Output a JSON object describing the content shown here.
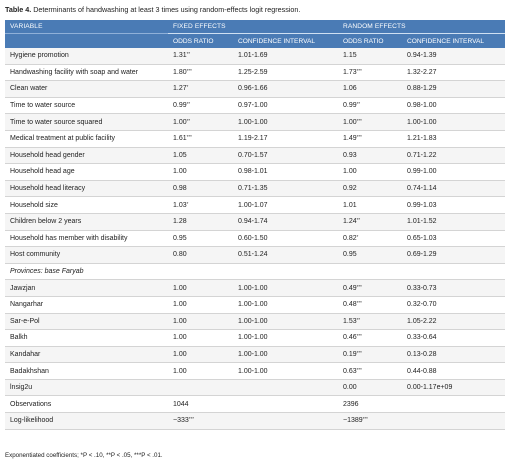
{
  "caption": {
    "label": "Table 4.",
    "text": " Determinants of handwashing at least 3 times using random-effects logit regression."
  },
  "header": {
    "variable": "VARIABLE",
    "fixed_effects": "FIXED EFFECTS",
    "random_effects": "RANDOM EFFECTS",
    "odds_ratio": "ODDS RATIO",
    "confidence_interval": "CONFIDENCE INTERVAL"
  },
  "rows": [
    {
      "variable": "Hygiene promotion",
      "fe_or": "1.31",
      "fe_sig": "**",
      "fe_ci": "1.01-1.69",
      "re_or": "1.15",
      "re_sig": "",
      "re_ci": "0.94-1.39"
    },
    {
      "variable": "Handwashing facility with soap and water",
      "fe_or": "1.80",
      "fe_sig": "***",
      "fe_ci": "1.25-2.59",
      "re_or": "1.73",
      "re_sig": "***",
      "re_ci": "1.32-2.27"
    },
    {
      "variable": "Clean water",
      "fe_or": "1.27",
      "fe_sig": "*",
      "fe_ci": "0.96-1.66",
      "re_or": "1.06",
      "re_sig": "",
      "re_ci": "0.88-1.29"
    },
    {
      "variable": "Time to water source",
      "fe_or": "0.99",
      "fe_sig": "**",
      "fe_ci": "0.97-1.00",
      "re_or": "0.99",
      "re_sig": "**",
      "re_ci": "0.98-1.00"
    },
    {
      "variable": "Time to water source squared",
      "fe_or": "1.00",
      "fe_sig": "**",
      "fe_ci": "1.00-1.00",
      "re_or": "1.00",
      "re_sig": "***",
      "re_ci": "1.00-1.00"
    },
    {
      "variable": "Medical treatment at public facility",
      "fe_or": "1.61",
      "fe_sig": "***",
      "fe_ci": "1.19-2.17",
      "re_or": "1.49",
      "re_sig": "***",
      "re_ci": "1.21-1.83"
    },
    {
      "variable": "Household head gender",
      "fe_or": "1.05",
      "fe_sig": "",
      "fe_ci": "0.70-1.57",
      "re_or": "0.93",
      "re_sig": "",
      "re_ci": "0.71-1.22"
    },
    {
      "variable": "Household head age",
      "fe_or": "1.00",
      "fe_sig": "",
      "fe_ci": "0.98-1.01",
      "re_or": "1.00",
      "re_sig": "",
      "re_ci": "0.99-1.00"
    },
    {
      "variable": "Household head literacy",
      "fe_or": "0.98",
      "fe_sig": "",
      "fe_ci": "0.71-1.35",
      "re_or": "0.92",
      "re_sig": "",
      "re_ci": "0.74-1.14"
    },
    {
      "variable": "Household size",
      "fe_or": "1.03",
      "fe_sig": "*",
      "fe_ci": "1.00-1.07",
      "re_or": "1.01",
      "re_sig": "",
      "re_ci": "0.99-1.03"
    },
    {
      "variable": "Children below 2 years",
      "fe_or": "1.28",
      "fe_sig": "",
      "fe_ci": "0.94-1.74",
      "re_or": "1.24",
      "re_sig": "**",
      "re_ci": "1.01-1.52"
    },
    {
      "variable": "Household has member with disability",
      "fe_or": "0.95",
      "fe_sig": "",
      "fe_ci": "0.60-1.50",
      "re_or": "0.82",
      "re_sig": "*",
      "re_ci": "0.65-1.03"
    },
    {
      "variable": "Host community",
      "fe_or": "0.80",
      "fe_sig": "",
      "fe_ci": "0.51-1.24",
      "re_or": "0.95",
      "re_sig": "",
      "re_ci": "0.69-1.29"
    },
    {
      "section": "Provinces: base Faryab"
    },
    {
      "variable": "Jawzjan",
      "fe_or": "1.00",
      "fe_sig": "",
      "fe_ci": "1.00-1.00",
      "re_or": "0.49",
      "re_sig": "***",
      "re_ci": "0.33-0.73"
    },
    {
      "variable": "Nangarhar",
      "fe_or": "1.00",
      "fe_sig": "",
      "fe_ci": "1.00-1.00",
      "re_or": "0.48",
      "re_sig": "***",
      "re_ci": "0.32-0.70"
    },
    {
      "variable": "Sar-e-Pol",
      "fe_or": "1.00",
      "fe_sig": "",
      "fe_ci": "1.00-1.00",
      "re_or": "1.53",
      "re_sig": "**",
      "re_ci": "1.05-2.22"
    },
    {
      "variable": "Balkh",
      "fe_or": "1.00",
      "fe_sig": "",
      "fe_ci": "1.00-1.00",
      "re_or": "0.46",
      "re_sig": "***",
      "re_ci": "0.33-0.64"
    },
    {
      "variable": "Kandahar",
      "fe_or": "1.00",
      "fe_sig": "",
      "fe_ci": "1.00-1.00",
      "re_or": "0.19",
      "re_sig": "***",
      "re_ci": "0.13-0.28"
    },
    {
      "variable": "Badakhshan",
      "fe_or": "1.00",
      "fe_sig": "",
      "fe_ci": "1.00-1.00",
      "re_or": "0.63",
      "re_sig": "***",
      "re_ci": "0.44-0.88"
    },
    {
      "variable": "lnsig2u",
      "fe_or": "",
      "fe_sig": "",
      "fe_ci": "",
      "re_or": "0.00",
      "re_sig": "",
      "re_ci": "0.00-1.17e+09"
    },
    {
      "variable": "Observations",
      "fe_or": "1044",
      "fe_sig": "",
      "fe_ci": "",
      "re_or": "2396",
      "re_sig": "",
      "re_ci": ""
    },
    {
      "variable": "Log-likelihood",
      "fe_or": "−333",
      "fe_sig": "***",
      "fe_ci": "",
      "re_or": "−1389",
      "re_sig": "***",
      "re_ci": ""
    }
  ],
  "footnote": "Exponentiated coefficients; *P < .10, **P < .05, ***P < .01.",
  "colors": {
    "header_bg": "#4a7bb5",
    "stripe": "#f5f5f5"
  }
}
